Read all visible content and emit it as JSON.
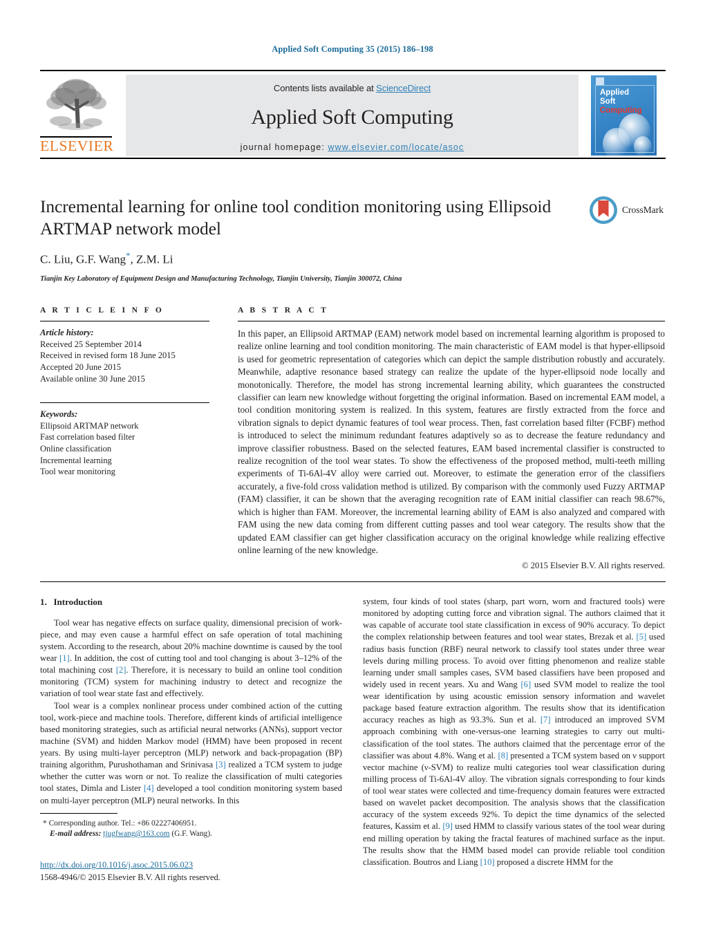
{
  "running_head": "Applied Soft Computing 35 (2015) 186–198",
  "masthead": {
    "contents_prefix": "Contents lists available at ",
    "sciencedirect": "ScienceDirect",
    "journal_title": "Applied Soft Computing",
    "homepage_label": "journal homepage:",
    "homepage_url": "www.elsevier.com/locate/asoc",
    "publisher": "ELSEVIER",
    "cover": {
      "line1": "Applied",
      "line2": "Soft",
      "line3": "Computing"
    },
    "accent_blue": "#2c7fb8",
    "elsevier_orange": "#E87722"
  },
  "article": {
    "title": "Incremental learning for online tool condition monitoring using Ellipsoid ARTMAP network model",
    "authors": "C. Liu, G.F. Wang",
    "authors_tail": ", Z.M. Li",
    "affiliation": "Tianjin Key Laboratory of Equipment Design and Manufacturing Technology, Tianjin University, Tianjin 300072, China",
    "crossmark_label": "CrossMark"
  },
  "info": {
    "heading": "A R T I C L E    I N F O",
    "history_label": "Article history:",
    "history": [
      "Received 25 September 2014",
      "Received in revised form 18 June 2015",
      "Accepted 20 June 2015",
      "Available online 30 June 2015"
    ],
    "keywords_label": "Keywords:",
    "keywords": [
      "Ellipsoid ARTMAP network",
      "Fast correlation based filter",
      "Online classification",
      "Incremental learning",
      "Tool wear monitoring"
    ]
  },
  "abstract": {
    "heading": "A B S T R A C T",
    "text": "In this paper, an Ellipsoid ARTMAP (EAM) network model based on incremental learning algorithm is proposed to realize online learning and tool condition monitoring. The main characteristic of EAM model is that hyper-ellipsoid is used for geometric representation of categories which can depict the sample distribution robustly and accurately. Meanwhile, adaptive resonance based strategy can realize the update of the hyper-ellipsoid node locally and monotonically. Therefore, the model has strong incremental learning ability, which guarantees the constructed classifier can learn new knowledge without forgetting the original information. Based on incremental EAM model, a tool condition monitoring system is realized. In this system, features are firstly extracted from the force and vibration signals to depict dynamic features of tool wear process. Then, fast correlation based filter (FCBF) method is introduced to select the minimum redundant features adaptively so as to decrease the feature redundancy and improve classifier robustness. Based on the selected features, EAM based incremental classifier is constructed to realize recognition of the tool wear states. To show the effectiveness of the proposed method, multi-teeth milling experiments of Ti-6Al-4V alloy were carried out. Moreover, to estimate the generation error of the classifiers accurately, a five-fold cross validation method is utilized. By comparison with the commonly used Fuzzy ARTMAP (FAM) classifier, it can be shown that the averaging recognition rate of EAM initial classifier can reach 98.67%, which is higher than FAM. Moreover, the incremental learning ability of EAM is also analyzed and compared with FAM using the new data coming from different cutting passes and tool wear category. The results show that the updated EAM classifier can get higher classification accuracy on the original knowledge while realizing effective online learning of the new knowledge.",
    "copyright": "© 2015 Elsevier B.V. All rights reserved."
  },
  "body": {
    "section_number": "1.",
    "section_title": "Introduction",
    "left_paragraphs": [
      {
        "parts": [
          {
            "t": "Tool wear has negative effects on surface quality, dimensional precision of work-piece, and may even cause a harmful effect on safe operation of total machining system. According to the research, about 20% machine downtime is caused by the tool wear "
          },
          {
            "t": "[1]",
            "ref": true
          },
          {
            "t": ". In addition, the cost of cutting tool and tool changing is about 3–12% of the total machining cost "
          },
          {
            "t": "[2]",
            "ref": true
          },
          {
            "t": ". Therefore, it is necessary to build an online tool condition monitoring (TCM) system for machining industry to detect and recognize the variation of tool wear state fast and effectively."
          }
        ]
      },
      {
        "parts": [
          {
            "t": "Tool wear is a complex nonlinear process under combined action of the cutting tool, work-piece and machine tools. Therefore, different kinds of artificial intelligence based monitoring strategies, such as artificial neural networks (ANNs), support vector machine (SVM) and hidden Markov model (HMM) have been proposed in recent years. By using multi-layer perceptron (MLP) network and back-propagation (BP) training algorithm, Purushothaman and Srinivasa "
          },
          {
            "t": "[3]",
            "ref": true
          },
          {
            "t": " realized a TCM system to judge whether the cutter was worn or not. To realize the classification of multi categories tool states, Dimla and Lister "
          },
          {
            "t": "[4]",
            "ref": true
          },
          {
            "t": " developed a tool condition monitoring system based on multi-layer perceptron (MLP) neural networks. In this"
          }
        ]
      }
    ],
    "right_paragraphs": [
      {
        "continued": true,
        "parts": [
          {
            "t": "system, four kinds of tool states (sharp, part worn, worn and fractured tools) were monitored by adopting cutting force and vibration signal. The authors claimed that it was capable of accurate tool state classification in excess of 90% accuracy. To depict the complex relationship between features and tool wear states, Brezak et al. "
          },
          {
            "t": "[5]",
            "ref": true
          },
          {
            "t": " used radius basis function (RBF) neural network to classify tool states under three wear levels during milling process. To avoid over fitting phenomenon and realize stable learning under small samples cases, SVM based classifiers have been proposed and widely used in recent years. Xu and Wang "
          },
          {
            "t": "[6]",
            "ref": true
          },
          {
            "t": " used SVM model to realize the tool wear identification by using acoustic emission sensory information and wavelet package based feature extraction algorithm. The results show that its identification accuracy reaches as high as 93.3%. Sun et al. "
          },
          {
            "t": "[7]",
            "ref": true
          },
          {
            "t": " introduced an improved SVM approach combining with one-versus-one learning strategies to carry out multi-classification of the tool states. The authors claimed that the percentage error of the classifier was about 4.8%. Wang et al. "
          },
          {
            "t": "[8]",
            "ref": true
          },
          {
            "t": " presented a TCM system based on ν support vector machine (ν-SVM) to realize multi categories tool wear classification during milling process of Ti-6Al-4V alloy. The vibration signals corresponding to four kinds of tool wear states were collected and time-frequency domain features were extracted based on wavelet packet decomposition. The analysis shows that the classification accuracy of the system exceeds 92%. To depict the time dynamics of the selected features, Kassim et al. "
          },
          {
            "t": "[9]",
            "ref": true
          },
          {
            "t": " used HMM to classify various states of the tool wear during end milling operation by taking the fractal features of machined surface as the input. The results show that the HMM based model can provide reliable tool condition classification. Boutros and Liang "
          },
          {
            "t": "[10]",
            "ref": true
          },
          {
            "t": " proposed a discrete HMM for the"
          }
        ]
      }
    ]
  },
  "footnote": {
    "marker": "*",
    "corresponding": "Corresponding author. Tel.: +86 02227406951.",
    "email_label": "E-mail address:",
    "email": "tjugfwang@163.com",
    "email_owner": "(G.F. Wang)."
  },
  "footer": {
    "doi": "http://dx.doi.org/10.1016/j.asoc.2015.06.023",
    "issn_line": "1568-4946/© 2015 Elsevier B.V. All rights reserved."
  }
}
